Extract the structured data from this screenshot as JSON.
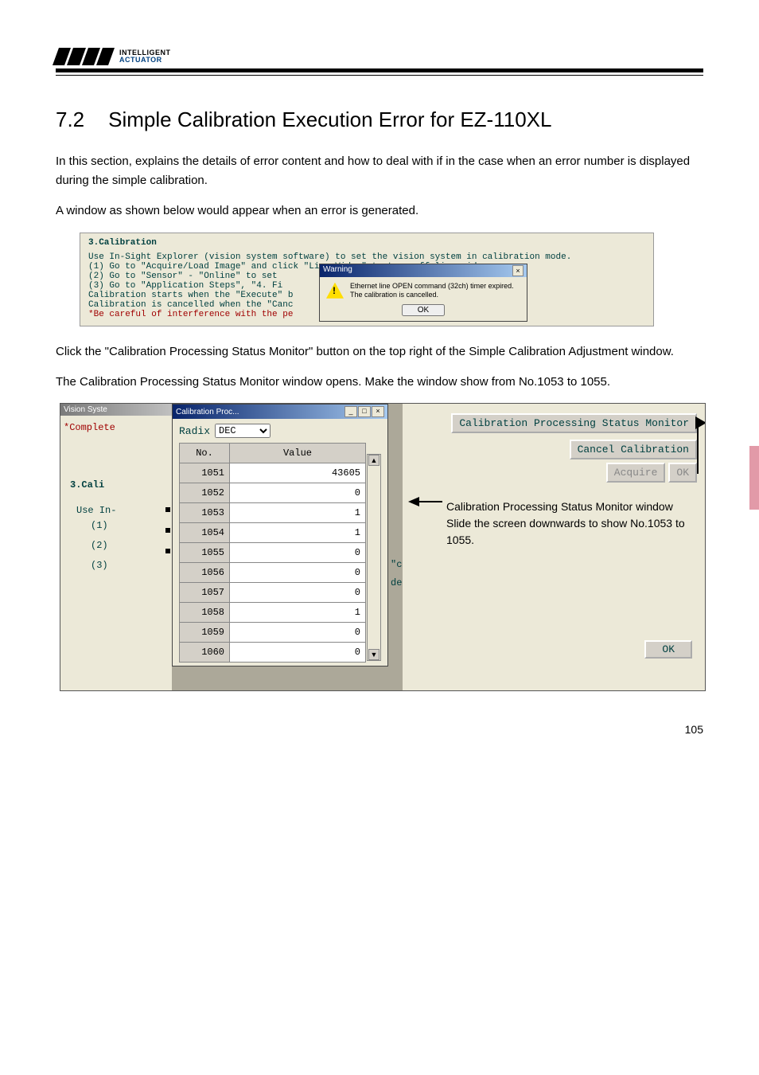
{
  "logo": {
    "line1": "INTELLIGENT",
    "line2": "ACTUATOR"
  },
  "heading": {
    "number": "7.2",
    "title": "Simple Calibration Execution Error for EZ-110XL"
  },
  "intro1": "In this section, explains the details of error content and how to deal with if in the case when an error number is displayed during the simple calibration.",
  "intro2": "A window as shown below would appear when an error is generated.",
  "shot1": {
    "title": "3.Calibration",
    "desc": "Use In-Sight Explorer (vision system software) to set the vision system in calibration mode.",
    "steps": [
      "(1) Go to \"Acquire/Load Image\" and click \"Live Video\" to turn off live video.",
      "(2) Go to \"Sensor\" - \"Online\" to set",
      "(3) Go to \"Application Steps\", \"4. Fi"
    ],
    "notes": {
      "n1": "Calibration starts when the \"Execute\" b",
      "n2": "Calibration is cancelled when the \"Canc",
      "n3": "*Be careful of interference with the pe"
    },
    "warning": {
      "title": "Warning",
      "msg1": "Ethernet line OPEN command (32ch) timer expired.",
      "msg2": "The calibration is cancelled.",
      "ok": "OK"
    }
  },
  "mid1": "Click the \"Calibration Processing Status Monitor\" button on the top right of the Simple Calibration Adjustment window.",
  "mid2": "The Calibration Processing Status Monitor window opens. Make the window show from No.1053 to 1055.",
  "shot2": {
    "left_titlebar": "Vision Syste",
    "complete": "*Complete",
    "cali": "3.Cali",
    "usein": "Use In-",
    "rows": [
      "(1)",
      "(2)",
      "(3)"
    ],
    "calibr_partial": "Calibr",
    "proc_title": "Calibration Proc...",
    "radix_label": "Radix",
    "radix_value": "DEC",
    "cols": {
      "no": "No.",
      "value": "Value"
    },
    "table": [
      {
        "no": "1051",
        "v": "43605"
      },
      {
        "no": "1052",
        "v": "0"
      },
      {
        "no": "1053",
        "v": "1"
      },
      {
        "no": "1054",
        "v": "1"
      },
      {
        "no": "1055",
        "v": "0"
      },
      {
        "no": "1056",
        "v": "0"
      },
      {
        "no": "1057",
        "v": "0"
      },
      {
        "no": "1058",
        "v": "1"
      },
      {
        "no": "1059",
        "v": "0"
      },
      {
        "no": "1060",
        "v": "0"
      }
    ],
    "frag1": "calib",
    "frag2": "deo.",
    "right": {
      "monitor_btn": "Calibration Processing Status Monitor",
      "cancel_btn": "Cancel Calibration",
      "acquire_btn": "Acquire",
      "ok_btn_top": "OK",
      "ok_btn_bottom": "OK"
    },
    "callout": {
      "l1": "Calibration Processing Status Monitor window",
      "l2": "Slide the screen downwards to show No.1053 to 1055."
    }
  },
  "page_number": "105"
}
